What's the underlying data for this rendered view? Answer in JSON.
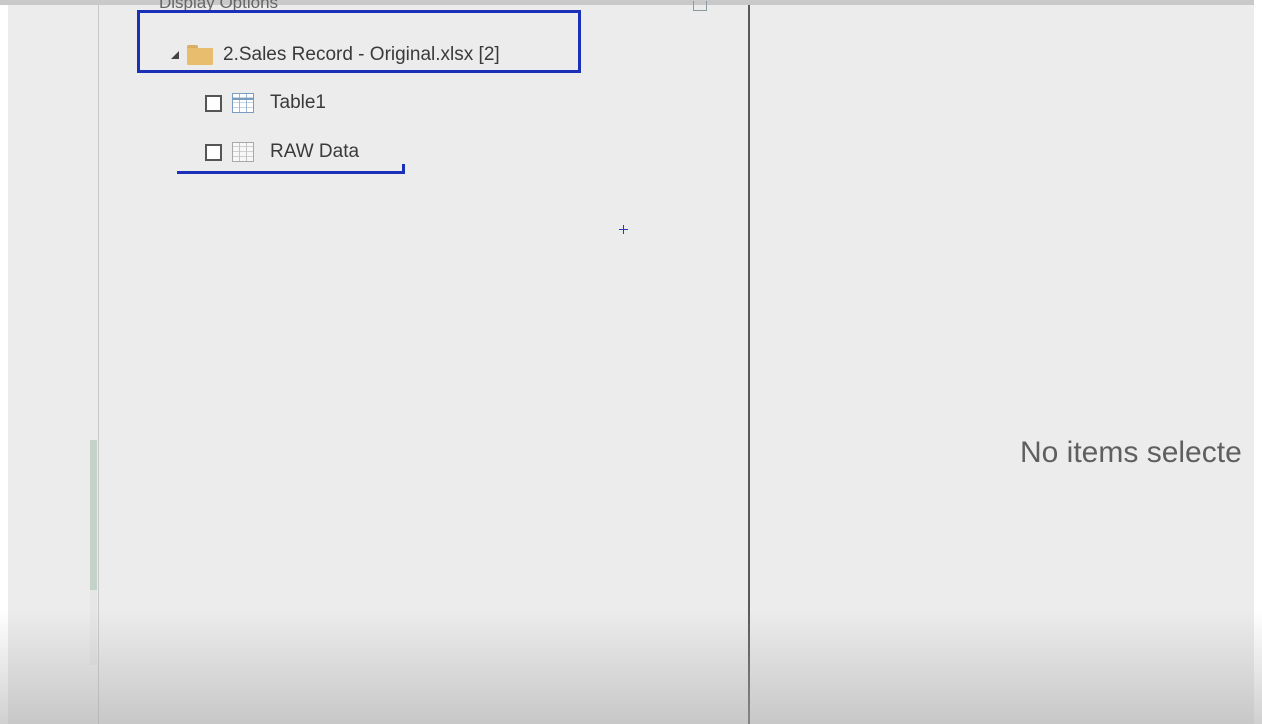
{
  "navigator": {
    "section_title": "Display Options",
    "root": {
      "label": "2.Sales Record - Original.xlsx [2]",
      "expanded": true
    },
    "items": [
      {
        "label": "Table1",
        "icon": "table-icon",
        "checked": false
      },
      {
        "label": "RAW Data",
        "icon": "sheet-icon",
        "checked": false
      }
    ]
  },
  "preview": {
    "empty_message": "No items selecte"
  },
  "colors": {
    "annotation": "#1b2fb8",
    "panel_background": "#ececec",
    "divider": "#5a5a5a"
  }
}
